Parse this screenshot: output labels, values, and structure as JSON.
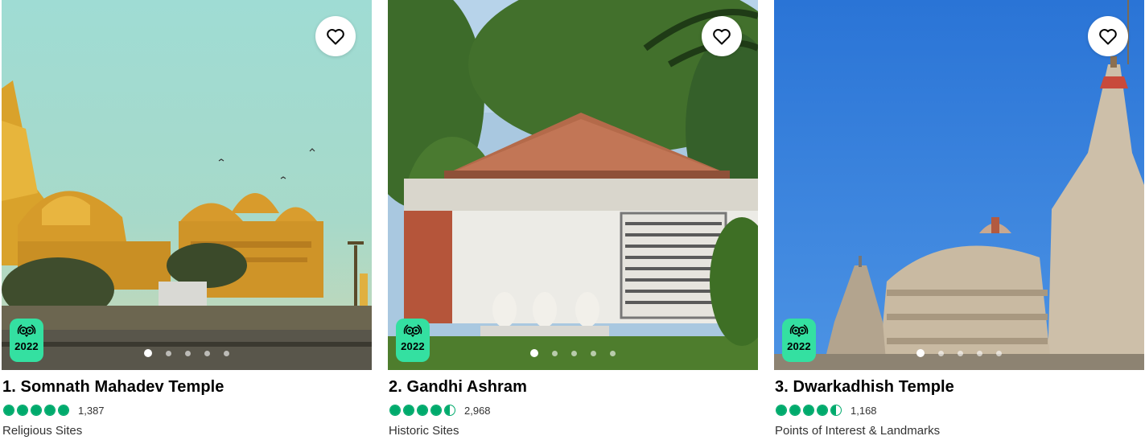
{
  "cards": [
    {
      "title": "1. Somnath Mahadev Temple",
      "rating": 5.0,
      "review_count": "1,387",
      "category": "Religious Sites",
      "award_year": "2022",
      "carousel_dots": 5,
      "active_dot": 0,
      "icons": [
        "heart-icon",
        "travellers-choice-owl-icon"
      ]
    },
    {
      "title": "2. Gandhi Ashram",
      "rating": 4.5,
      "review_count": "2,968",
      "category": "Historic Sites",
      "award_year": "2022",
      "carousel_dots": 5,
      "active_dot": 0,
      "icons": [
        "heart-icon",
        "travellers-choice-owl-icon"
      ]
    },
    {
      "title": "3. Dwarkadhish Temple",
      "rating": 4.5,
      "review_count": "1,168",
      "category": "Points of Interest & Landmarks",
      "award_year": "2022",
      "carousel_dots": 5,
      "active_dot": 0,
      "icons": [
        "heart-icon",
        "travellers-choice-owl-icon"
      ]
    }
  ],
  "colors": {
    "rating_green": "#00aa6c",
    "award_badge": "#34e0a1"
  }
}
